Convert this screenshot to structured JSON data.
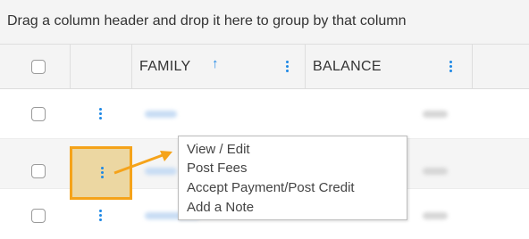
{
  "group_bar": {
    "text": "Drag a column header and drop it here to group by that column"
  },
  "columns": [
    {
      "label": "FAMILY",
      "sort_icon": "sort-ascending-arrow"
    },
    {
      "label": "BALANCE"
    }
  ],
  "context_menu": {
    "items": [
      "View / Edit",
      "Post Fees",
      "Accept Payment/Post Credit",
      "Add a Note"
    ]
  },
  "colors": {
    "accent": "#1e88e5",
    "highlight_border": "#f5a31a",
    "highlight_fill": "#ecd7a2"
  },
  "icons": {
    "row_menu": "vertical-dots-icon",
    "column_menu": "vertical-dots-icon"
  }
}
